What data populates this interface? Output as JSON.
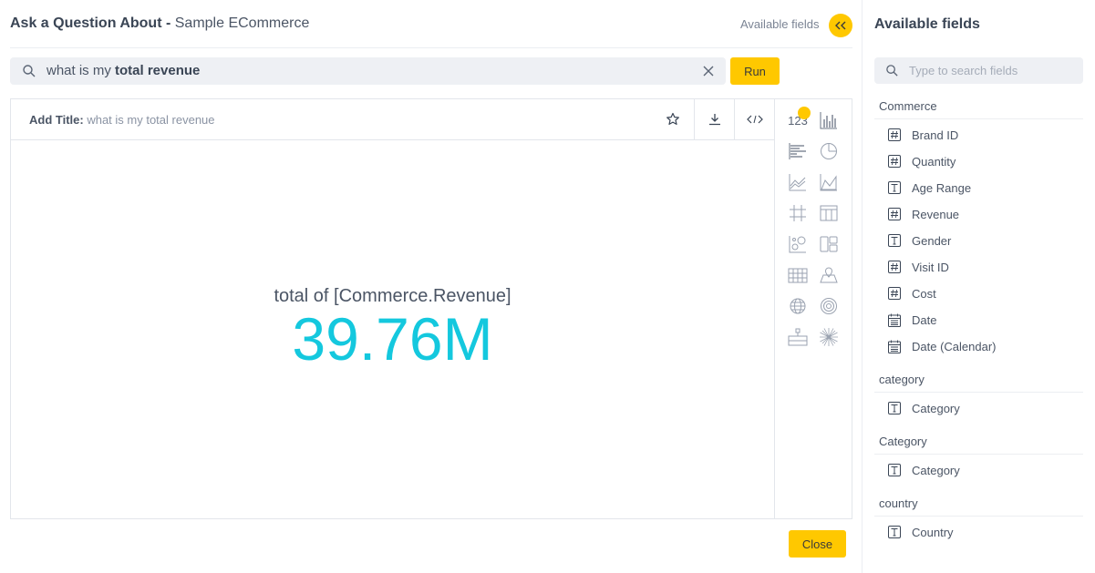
{
  "header": {
    "title_prefix": "Ask a Question About - ",
    "dataset_name": "Sample ECommerce",
    "available_fields_link": "Available fields"
  },
  "search": {
    "query_plain": "what is my ",
    "query_bold": "total revenue",
    "run_label": "Run"
  },
  "visualization": {
    "title_key": "Add Title:",
    "title_value": "what is my total revenue",
    "kpi_label": "total of [Commerce.Revenue]",
    "kpi_value": "39.76M",
    "kpi_color": "#14c8de"
  },
  "chart_types": {
    "active": "123",
    "items": [
      "number",
      "column-chart",
      "bar-chart",
      "pie-chart",
      "line-chart",
      "area-chart",
      "pivot-grid",
      "table",
      "scatter-chart",
      "treemap",
      "heatmap",
      "map",
      "geo-map",
      "radial-chart",
      "funnel",
      "sunburst"
    ]
  },
  "footer": {
    "close_label": "Close"
  },
  "sidebar": {
    "title": "Available fields",
    "search_placeholder": "Type to search fields",
    "groups": [
      {
        "name": "Commerce",
        "fields": [
          {
            "label": "Brand ID",
            "type": "number"
          },
          {
            "label": "Quantity",
            "type": "number"
          },
          {
            "label": "Age Range",
            "type": "text"
          },
          {
            "label": "Revenue",
            "type": "number"
          },
          {
            "label": "Gender",
            "type": "text"
          },
          {
            "label": "Visit ID",
            "type": "number"
          },
          {
            "label": "Cost",
            "type": "number"
          },
          {
            "label": "Date",
            "type": "date"
          },
          {
            "label": "Date (Calendar)",
            "type": "date"
          }
        ]
      },
      {
        "name": "category",
        "fields": [
          {
            "label": "Category",
            "type": "text"
          }
        ]
      },
      {
        "name": "Category",
        "fields": [
          {
            "label": "Category",
            "type": "text"
          }
        ]
      },
      {
        "name": "country",
        "fields": [
          {
            "label": "Country",
            "type": "text"
          }
        ]
      }
    ]
  },
  "colors": {
    "accent": "#ffc800",
    "kpi": "#14c8de"
  }
}
